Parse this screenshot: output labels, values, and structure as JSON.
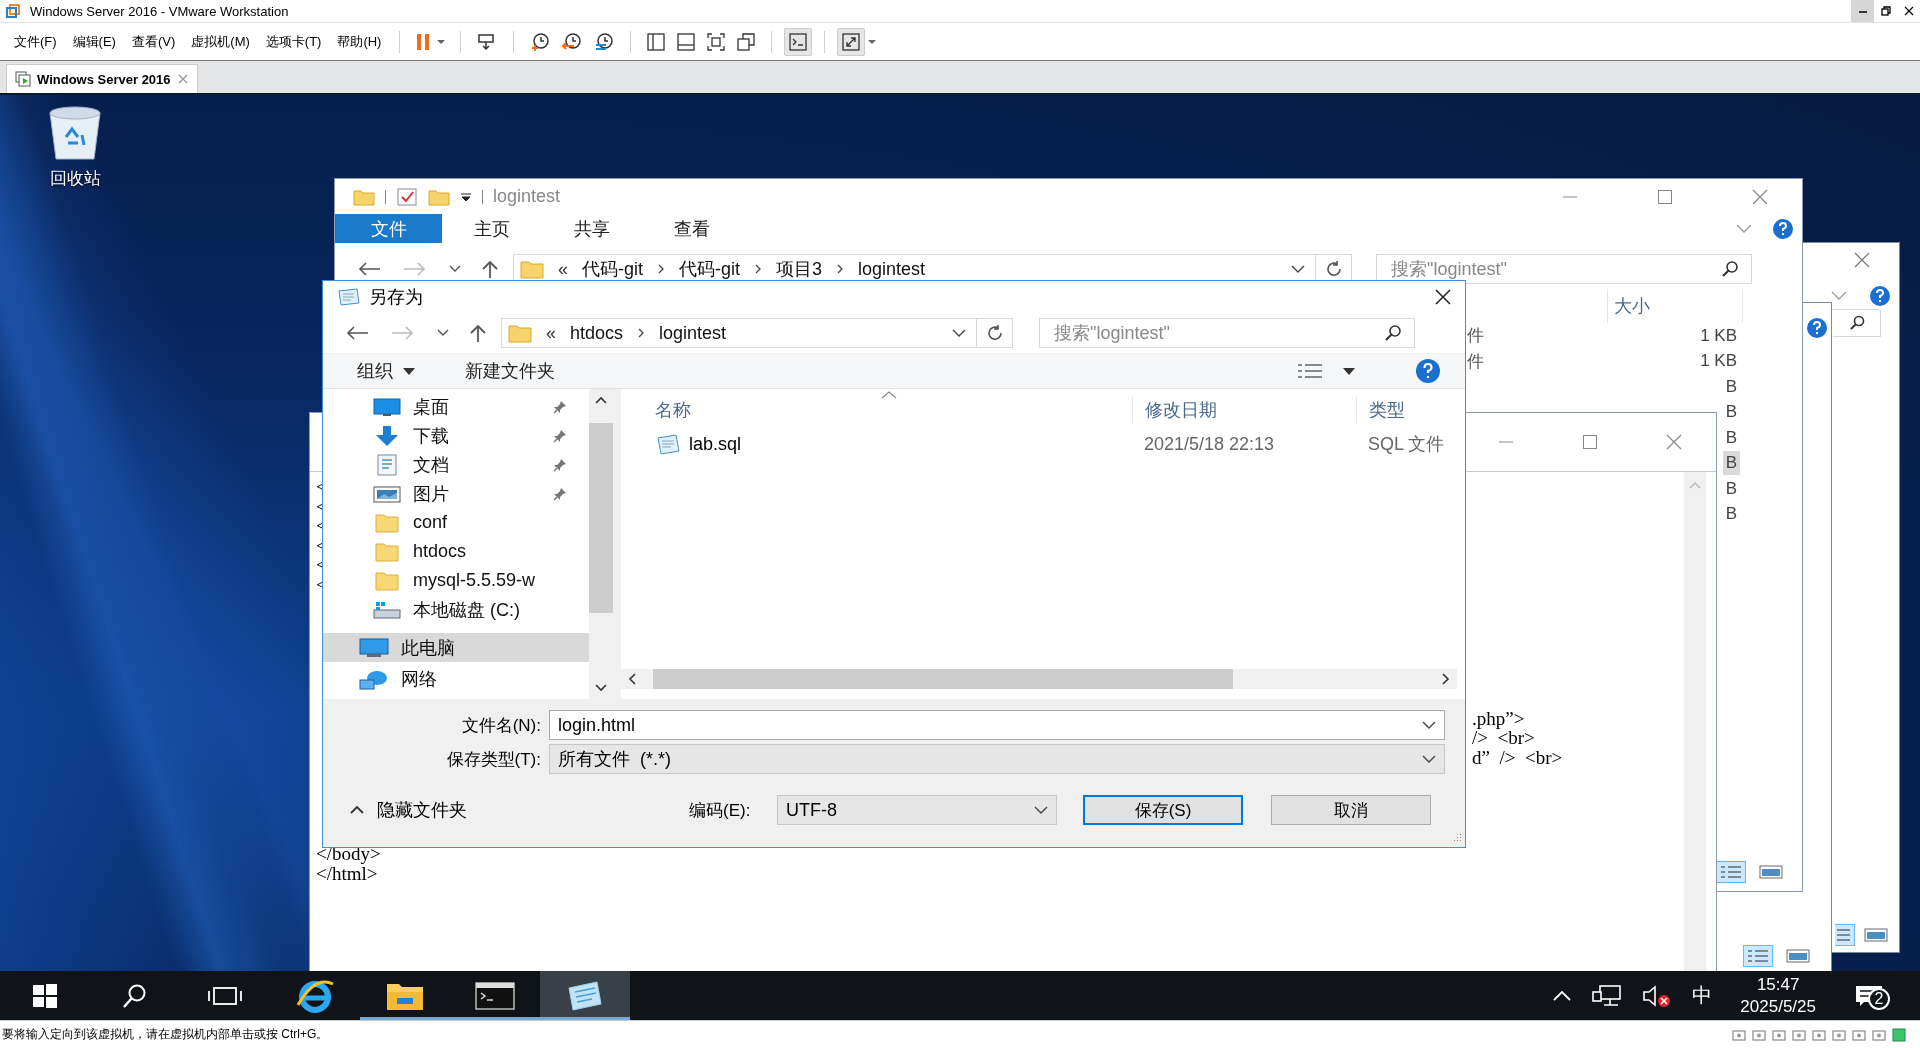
{
  "vmware": {
    "title": "Windows Server 2016 - VMware Workstation",
    "menu": [
      "文件(F)",
      "编辑(E)",
      "查看(V)",
      "虚拟机(M)",
      "选项卡(T)",
      "帮助(H)"
    ],
    "tabs": [
      {
        "label": "Windows Server 2016",
        "selected": true
      }
    ],
    "status_text": "要将输入定向到该虚拟机，请在虚拟机内部单击或按 Ctrl+G。"
  },
  "desktop_icons": [
    {
      "label": "回收站"
    }
  ],
  "explorer": {
    "title": "logintest",
    "ribbon_tabs": [
      {
        "label": "文件",
        "selected": true
      },
      {
        "label": "主页",
        "selected": false
      },
      {
        "label": "共享",
        "selected": false
      },
      {
        "label": "查看",
        "selected": false
      }
    ],
    "overflow": "«",
    "path": [
      "代码-git",
      "代码-git",
      "项目3",
      "logintest"
    ],
    "search": {
      "placeholder": "搜索\"logintest\""
    },
    "size_column": "大小",
    "rows": [
      {
        "type": "件",
        "size": "1 KB",
        "selected": false
      },
      {
        "type": "件",
        "size": "1 KB",
        "selected": false
      },
      {
        "size": "B",
        "selected": false
      },
      {
        "size": "B",
        "selected": false
      },
      {
        "size": "B",
        "selected": false
      },
      {
        "size": "B",
        "selected": true
      },
      {
        "size": "B",
        "selected": false
      },
      {
        "size": "B",
        "selected": false
      }
    ]
  },
  "notepad": {
    "left_fragments": [
      "<",
      "<",
      "<",
      "<",
      "<",
      "<"
    ],
    "right_fragments": [
      ".php”>",
      "/>  <br>",
      "d”  />  <br>"
    ],
    "closing_lines": [
      "</body>",
      "</html>"
    ]
  },
  "dialog": {
    "title": "另存为",
    "overflow": "«",
    "path": [
      "htdocs",
      "logintest"
    ],
    "search": {
      "placeholder": "搜索\"logintest\""
    },
    "organize": "组织",
    "new_folder": "新建文件夹",
    "quick_access": [
      {
        "label": "桌面",
        "kind": "desktop",
        "pinned": true
      },
      {
        "label": "下载",
        "kind": "download",
        "pinned": true
      },
      {
        "label": "文档",
        "kind": "document",
        "pinned": true
      },
      {
        "label": "图片",
        "kind": "picture",
        "pinned": true
      },
      {
        "label": "conf",
        "kind": "folder",
        "pinned": false
      },
      {
        "label": "htdocs",
        "kind": "folder",
        "pinned": false
      },
      {
        "label": "mysql-5.5.59-w",
        "kind": "folder",
        "pinned": false
      },
      {
        "label": "本地磁盘 (C:)",
        "kind": "drive",
        "pinned": false
      }
    ],
    "locations": [
      {
        "label": "此电脑",
        "kind": "computer",
        "selected": true
      },
      {
        "label": "网络",
        "kind": "network",
        "selected": false
      }
    ],
    "columns": [
      "名称",
      "修改日期",
      "类型"
    ],
    "files": [
      {
        "name": "lab.sql",
        "modified": "2021/5/18 22:13",
        "type": "SQL 文件"
      }
    ],
    "filename_label": "文件名(N):",
    "filename": "login.html",
    "filetype_label": "保存类型(T):",
    "filetype": "所有文件  (*.*)",
    "hide_folders": "隐藏文件夹",
    "encoding_label": "编码(E):",
    "encoding": "UTF-8",
    "buttons": [
      {
        "label": "保存(S)",
        "default": true
      },
      {
        "label": "取消",
        "default": false
      }
    ]
  },
  "taskbar": {
    "apps": [
      {
        "kind": "ie",
        "running": false,
        "selected": false
      },
      {
        "kind": "explorer",
        "running": true,
        "selected": false
      },
      {
        "kind": "cmd",
        "running": true,
        "selected": false
      },
      {
        "kind": "notepad",
        "running": true,
        "selected": true
      }
    ],
    "ime": "中",
    "time": "15:47",
    "date": "2025/5/25",
    "notifications": "2"
  }
}
